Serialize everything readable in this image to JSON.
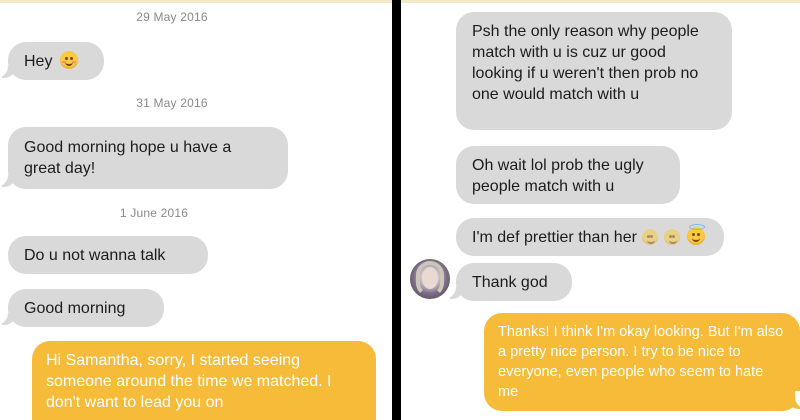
{
  "left_panel": {
    "dates": [
      "29 May 2016",
      "31 May 2016",
      "1 June 2016"
    ],
    "messages": [
      {
        "from": "them",
        "text": "Hey",
        "emoji": "smiling-face-emoji"
      },
      {
        "from": "them",
        "text": "Good morning hope u have a great day!"
      },
      {
        "from": "them",
        "text": "Do u not wanna talk"
      },
      {
        "from": "them",
        "text": "Good morning"
      },
      {
        "from": "me",
        "text": "Hi Samantha, sorry, I started seeing someone around the time we matched. I don't want to lead you on"
      }
    ]
  },
  "right_panel": {
    "messages": [
      {
        "from": "them",
        "text": "Psh the only reason why people match with u is cuz ur good looking if u weren't then prob no one would match with u"
      },
      {
        "from": "them",
        "text": "Oh wait lol prob the ugly people match with u"
      },
      {
        "from": "them",
        "text": "I'm def prettier than her",
        "emoji": "halo-smiling-face-emoji"
      },
      {
        "from": "them",
        "text": "Thank god"
      },
      {
        "from": "me",
        "text": "Thanks! I think I'm okay looking. But I'm also a pretty nice person. I try to be nice to everyone, even people who seem to hate me"
      }
    ]
  },
  "colors": {
    "incoming_bubble": "#d9d9d9",
    "outgoing_bubble": "#f7bb3a",
    "divider": "#000000",
    "date_text": "#8a8a8a"
  }
}
